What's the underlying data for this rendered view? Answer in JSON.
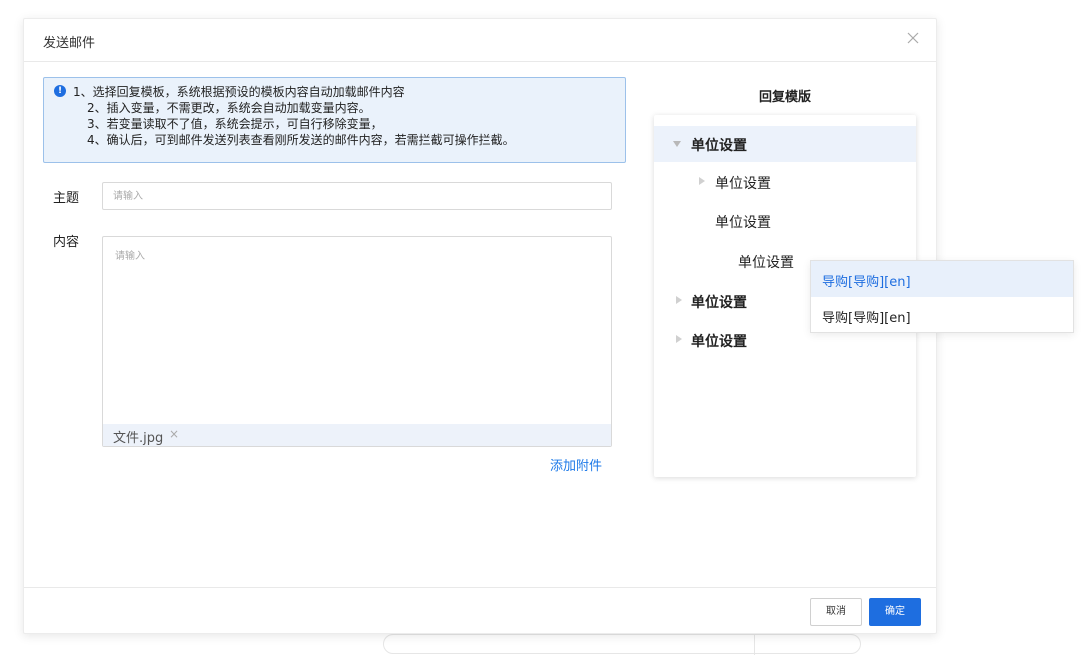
{
  "modal": {
    "title": "发送邮件"
  },
  "notice": {
    "lines": [
      "1、选择回复模板，系统根据预设的模板内容自动加载邮件内容",
      "2、插入变量，不需更改，系统会自动加载变量内容。",
      "3、若变量读取不了值，系统会提示，可自行移除变量，",
      "4、确认后，可到邮件发送列表查看刚所发送的邮件内容，若需拦截可操作拦截。"
    ]
  },
  "form": {
    "subject_label": "主题",
    "subject_placeholder": "请输入",
    "content_label": "内容",
    "content_placeholder": "请输入",
    "attachment": {
      "name": "文件.jpg",
      "remove": "×"
    },
    "add_attachment": "添加附件"
  },
  "template_panel": {
    "title": "回复模版",
    "nodes": [
      {
        "label": "单位设置",
        "expanded": true,
        "selected": true
      },
      {
        "label": "单位设置",
        "expanded": false
      },
      {
        "label": "单位设置"
      },
      {
        "label": "单位设置"
      },
      {
        "label": "单位设置",
        "expanded": false
      },
      {
        "label": "单位设置",
        "expanded": false
      }
    ]
  },
  "dropdown": {
    "options": [
      "导购[导购][en]",
      "导购[导购][en]"
    ],
    "active_index": 0
  },
  "footer": {
    "cancel": "取消",
    "ok": "确定"
  },
  "colors": {
    "primary": "#1e6ee0",
    "notice_bg": "#eaf2fb",
    "selected_bg": "#ecf2fb"
  }
}
